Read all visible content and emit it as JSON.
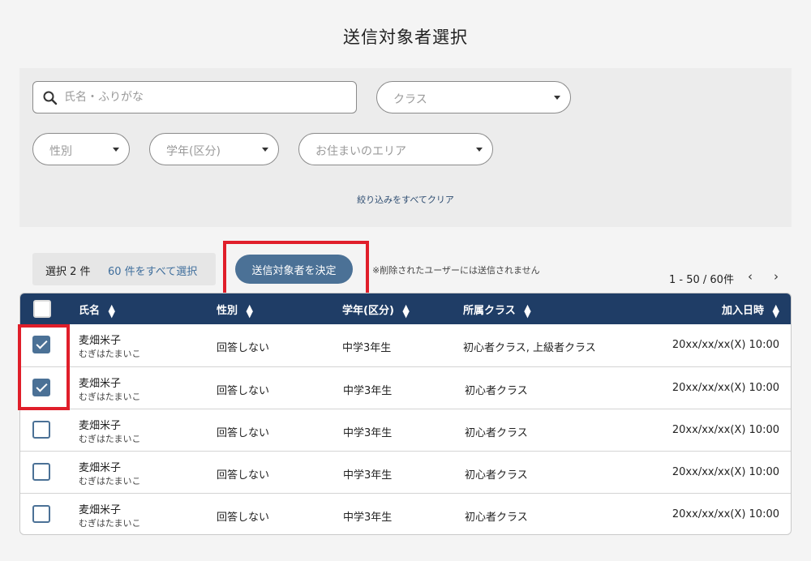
{
  "page": {
    "title": "送信対象者選択"
  },
  "filters": {
    "search_placeholder": "氏名・ふりがな",
    "class_placeholder": "クラス",
    "gender_placeholder": "性別",
    "grade_placeholder": "学年(区分)",
    "area_placeholder": "お住まいのエリア",
    "clear_label": "絞り込みをすべてクリア"
  },
  "selection": {
    "count_label": "選択 2 件",
    "select_all_label": "60 件をすべて選択",
    "confirm_label": "送信対象者を決定",
    "note": "※削除されたユーザーには送信されません"
  },
  "pagination": {
    "range": "1 - 50 / 60件",
    "prev": "‹",
    "next": "›"
  },
  "table": {
    "headers": {
      "name": "氏名",
      "gender": "性別",
      "grade": "学年(区分)",
      "class": "所属クラス",
      "joined": "加入日時"
    },
    "rows": [
      {
        "name": "麦畑米子",
        "kana": "むぎはたまいこ",
        "gender": "回答しない",
        "grade": "中学3年生",
        "class": "初心者クラス, 上級者クラス",
        "joined": "20xx/xx/xx(X) 10:00",
        "checked": true
      },
      {
        "name": "麦畑米子",
        "kana": "むぎはたまいこ",
        "gender": "回答しない",
        "grade": "中学3年生",
        "class": "初心者クラス",
        "joined": "20xx/xx/xx(X) 10:00",
        "checked": true
      },
      {
        "name": "麦畑米子",
        "kana": "むぎはたまいこ",
        "gender": "回答しない",
        "grade": "中学3年生",
        "class": "初心者クラス",
        "joined": "20xx/xx/xx(X) 10:00",
        "checked": false
      },
      {
        "name": "麦畑米子",
        "kana": "むぎはたまいこ",
        "gender": "回答しない",
        "grade": "中学3年生",
        "class": "初心者クラス",
        "joined": "20xx/xx/xx(X) 10:00",
        "checked": false
      },
      {
        "name": "麦畑米子",
        "kana": "むぎはたまいこ",
        "gender": "回答しない",
        "grade": "中学3年生",
        "class": "初心者クラス",
        "joined": "20xx/xx/xx(X) 10:00",
        "checked": false
      }
    ]
  },
  "colors": {
    "header_bg": "#1f3d66",
    "accent": "#4b7196",
    "highlight_frame": "#e01e2a",
    "link": "#3f6e9c"
  }
}
